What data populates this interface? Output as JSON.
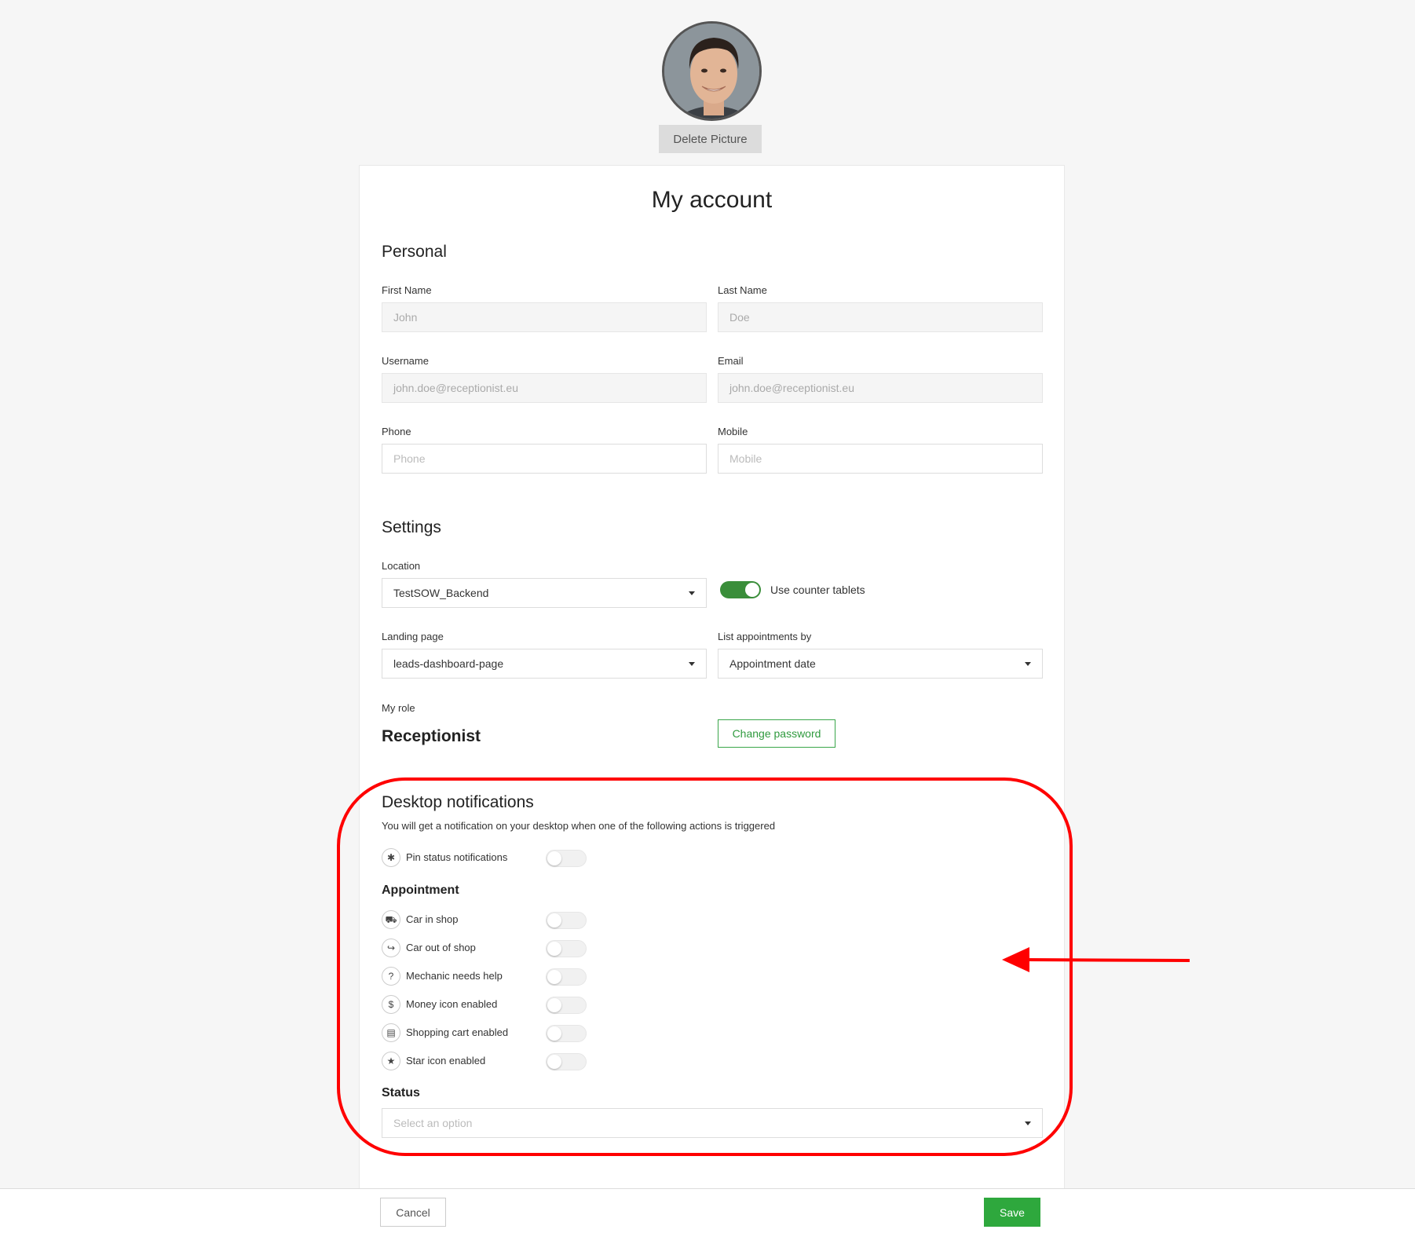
{
  "profile": {
    "delete_picture_label": "Delete Picture"
  },
  "page": {
    "title": "My account"
  },
  "personal": {
    "heading": "Personal",
    "first_name": {
      "label": "First Name",
      "value": "John"
    },
    "last_name": {
      "label": "Last Name",
      "value": "Doe"
    },
    "username": {
      "label": "Username",
      "value": "john.doe@receptionist.eu"
    },
    "email": {
      "label": "Email",
      "value": "john.doe@receptionist.eu"
    },
    "phone": {
      "label": "Phone",
      "placeholder": "Phone"
    },
    "mobile": {
      "label": "Mobile",
      "placeholder": "Mobile"
    }
  },
  "settings": {
    "heading": "Settings",
    "location": {
      "label": "Location",
      "value": "TestSOW_Backend"
    },
    "counter_tablets": {
      "label": "Use counter tablets",
      "enabled": true
    },
    "landing_page": {
      "label": "Landing page",
      "value": "leads-dashboard-page"
    },
    "list_appointments": {
      "label": "List appointments by",
      "value": "Appointment date"
    },
    "role_label": "My role",
    "role_value": "Receptionist",
    "change_password_label": "Change password"
  },
  "notifications": {
    "heading": "Desktop notifications",
    "description": "You will get a notification on your desktop when one of the following actions is triggered",
    "pin_status": {
      "label": "Pin status notifications",
      "icon": "pin-icon",
      "enabled": false
    },
    "appointment_heading": "Appointment",
    "appointment_items": [
      {
        "label": "Car in shop",
        "icon": "car-icon",
        "enabled": false
      },
      {
        "label": "Car out of shop",
        "icon": "sign-out-icon",
        "enabled": false
      },
      {
        "label": "Mechanic needs help",
        "icon": "question-icon",
        "enabled": false
      },
      {
        "label": "Money icon enabled",
        "icon": "dollar-icon",
        "enabled": false
      },
      {
        "label": "Shopping cart enabled",
        "icon": "cart-icon",
        "enabled": false
      },
      {
        "label": "Star icon enabled",
        "icon": "star-icon",
        "enabled": false
      }
    ],
    "status_heading": "Status",
    "status_placeholder": "Select an option"
  },
  "footer": {
    "cancel_label": "Cancel",
    "save_label": "Save"
  },
  "colors": {
    "accent_green": "#2ea83d",
    "annotation_red": "#ff0000"
  }
}
